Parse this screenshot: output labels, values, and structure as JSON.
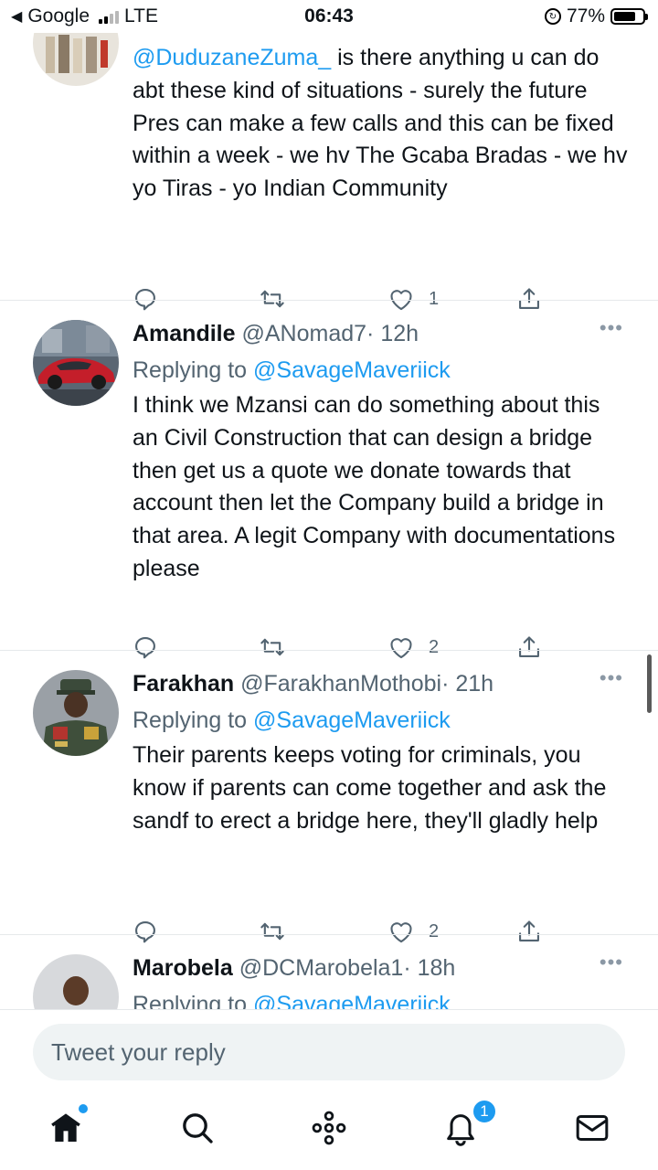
{
  "status_bar": {
    "carrier": "Google",
    "network": "LTE",
    "time": "06:43",
    "battery": "77%",
    "battery_level": 0.77
  },
  "tweets": [
    {
      "text_parts": [
        "@DuduzaneZuma_",
        " is there anything u can do abt these kind of situations - surely the future Pres can make a few calls and this can be fixed within a week - we hv The Gcaba Bradas - we hv yo Tiras - yo Indian Community"
      ],
      "likes": "1"
    },
    {
      "name": "Amandile",
      "handle": "@ANomad7",
      "time": "· 12h",
      "replying_label": "Replying to",
      "replying_to": "@SavageMaveriick",
      "text": "I think we Mzansi can do something about this an Civil Construction that can design a bridge then get us a quote we donate towards that account then let the Company build a bridge in that area. A legit Company with documentations please",
      "likes": "2"
    },
    {
      "name": "Farakhan",
      "handle": "@FarakhanMothobi",
      "time": "· 21h",
      "replying_label": "Replying to",
      "replying_to": "@SavageMaveriick",
      "text": "Their parents keeps voting for criminals, you know if parents can come together and ask the sandf to erect a bridge here, they'll gladly help",
      "likes": "2"
    },
    {
      "name": "Marobela",
      "handle": "@DCMarobela1",
      "time": "· 18h",
      "replying_label": "Replying to",
      "replying_to": "@SavageMaveriick"
    }
  ],
  "more_glyph": "•••",
  "reply_box": {
    "placeholder": "Tweet your reply"
  },
  "nav": {
    "notifications_badge": "1"
  },
  "colors": {
    "accent": "#1d9bf0",
    "secondary_text": "#536471"
  }
}
